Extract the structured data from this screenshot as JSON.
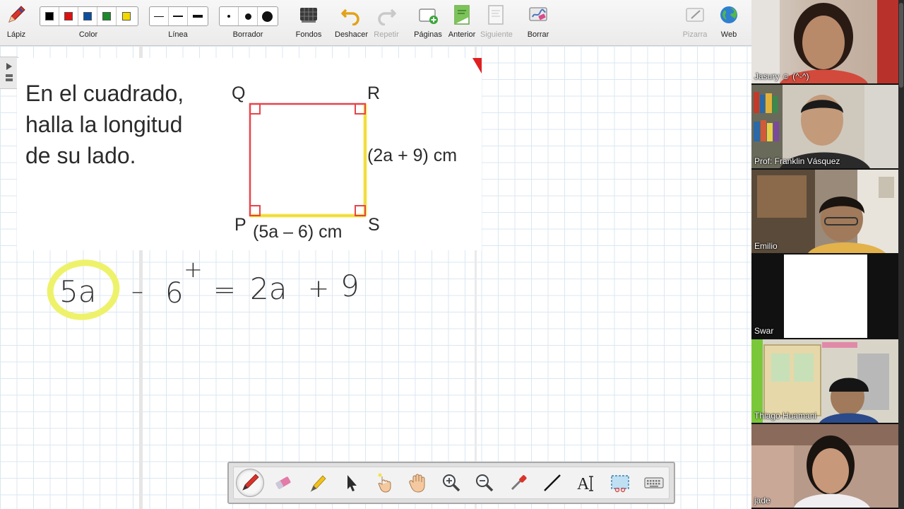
{
  "toolbar": {
    "pencil": "Lápiz",
    "color": "Color",
    "line": "Línea",
    "eraser": "Borrador",
    "backgrounds": "Fondos",
    "undo": "Deshacer",
    "redo": "Repetir",
    "pages": "Páginas",
    "previous": "Anterior",
    "next": "Siguiente",
    "clear": "Borrar",
    "whiteboard": "Pizarra",
    "web": "Web",
    "swatches": [
      "#000000",
      "#e01010",
      "#0d4f9e",
      "#1a8a2a",
      "#f2d800"
    ]
  },
  "problem": {
    "line1": "En el cuadrado,",
    "line2": "halla la longitud",
    "line3": "de su lado.",
    "q": "Q",
    "r": "R",
    "p": "P",
    "s": "S",
    "side_right": "(2a + 9) cm",
    "side_bottom": "(5a – 6) cm"
  },
  "equation": {
    "t1": "5a",
    "op1": "–",
    "t2": "6",
    "plus": "+",
    "eq": "=",
    "t3": "2a",
    "op2": "+",
    "t4": "9"
  },
  "participants": [
    {
      "name": "Jasury ☺ (^-^)"
    },
    {
      "name": "Prof: Franklin Vásquez"
    },
    {
      "name": "Emilio"
    },
    {
      "name": "Swar"
    },
    {
      "name": "Thiago Huamani"
    },
    {
      "name": "jade"
    }
  ],
  "colors": {
    "accent_red": "#e02020",
    "highlight": "#eef26a",
    "square_stroke": "#e8434a",
    "square_highlight": "#f3e840"
  }
}
